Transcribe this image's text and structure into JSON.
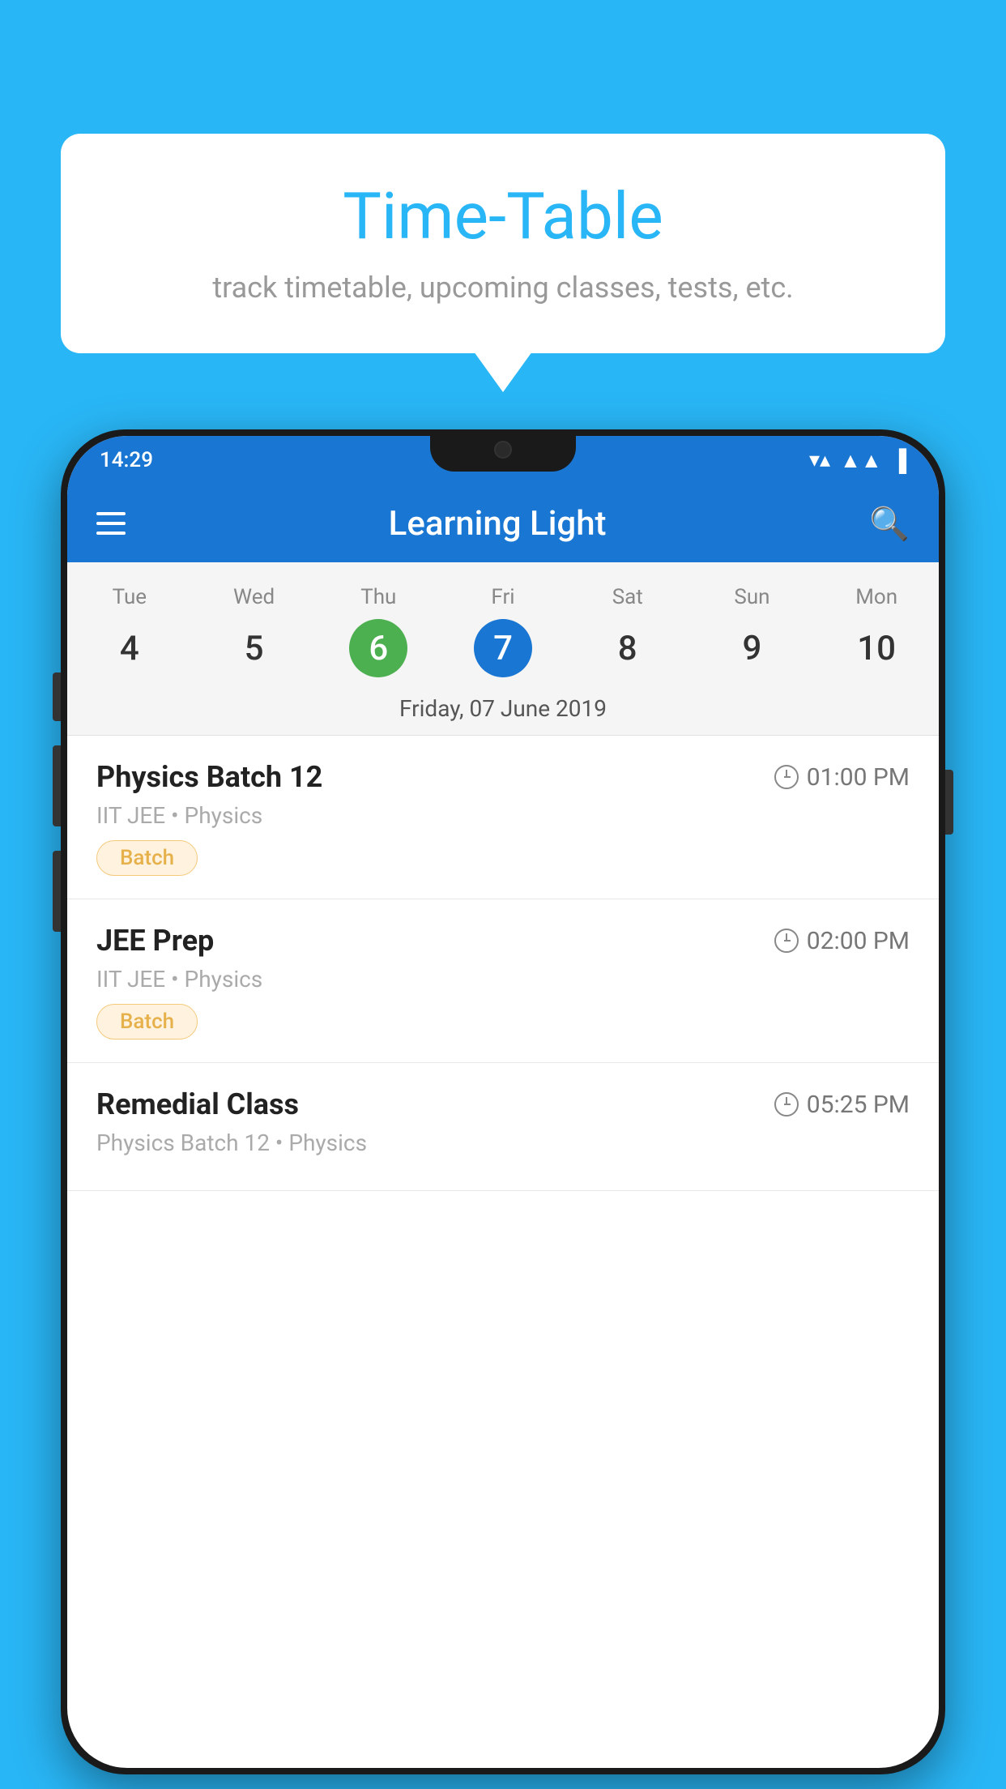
{
  "background_color": "#29B6F6",
  "bubble": {
    "title": "Time-Table",
    "subtitle": "track timetable, upcoming classes, tests, etc."
  },
  "status_bar": {
    "time": "14:29"
  },
  "app_bar": {
    "title": "Learning Light"
  },
  "calendar": {
    "selected_date_label": "Friday, 07 June 2019",
    "days": [
      {
        "label": "Tue",
        "number": "4",
        "state": "normal"
      },
      {
        "label": "Wed",
        "number": "5",
        "state": "normal"
      },
      {
        "label": "Thu",
        "number": "6",
        "state": "today"
      },
      {
        "label": "Fri",
        "number": "7",
        "state": "selected"
      },
      {
        "label": "Sat",
        "number": "8",
        "state": "normal"
      },
      {
        "label": "Sun",
        "number": "9",
        "state": "normal"
      },
      {
        "label": "Mon",
        "number": "10",
        "state": "normal"
      }
    ]
  },
  "schedule": {
    "items": [
      {
        "title": "Physics Batch 12",
        "time": "01:00 PM",
        "meta": "IIT JEE • Physics",
        "tag": "Batch"
      },
      {
        "title": "JEE Prep",
        "time": "02:00 PM",
        "meta": "IIT JEE • Physics",
        "tag": "Batch"
      },
      {
        "title": "Remedial Class",
        "time": "05:25 PM",
        "meta": "Physics Batch 12 • Physics",
        "tag": ""
      }
    ]
  }
}
